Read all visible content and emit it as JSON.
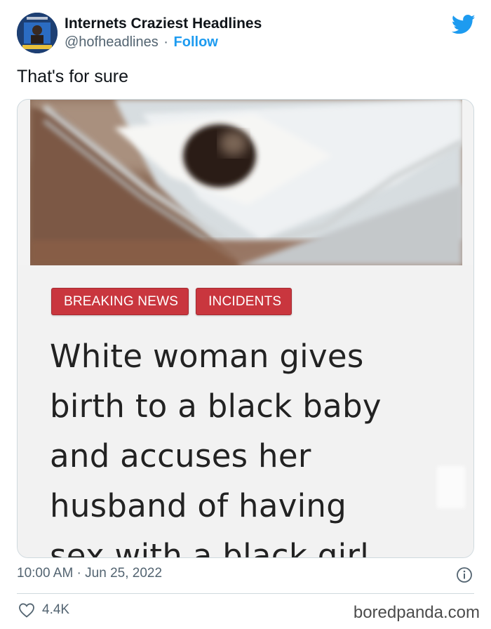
{
  "author": {
    "name": "Internets Craziest Headlines",
    "handle": "@hofheadlines",
    "separator": "·",
    "follow_label": "Follow"
  },
  "tweet": {
    "text": "That's for sure",
    "timestamp": "10:00 AM · Jun 25, 2022",
    "likes": "4.4K"
  },
  "media": {
    "badges": [
      "BREAKING NEWS",
      "INCIDENTS"
    ],
    "headline_lines": [
      "White woman gives",
      "birth to a black baby",
      "and accuses her",
      "husband of having",
      "sex with a black girl"
    ]
  },
  "icons": {
    "brand": "twitter-bird-icon",
    "info": "info-icon",
    "like": "heart-icon"
  },
  "colors": {
    "twitter_blue": "#1d9bf0",
    "badge_red": "#c9363e",
    "muted_text": "#536471"
  },
  "watermark": "boredpanda.com"
}
